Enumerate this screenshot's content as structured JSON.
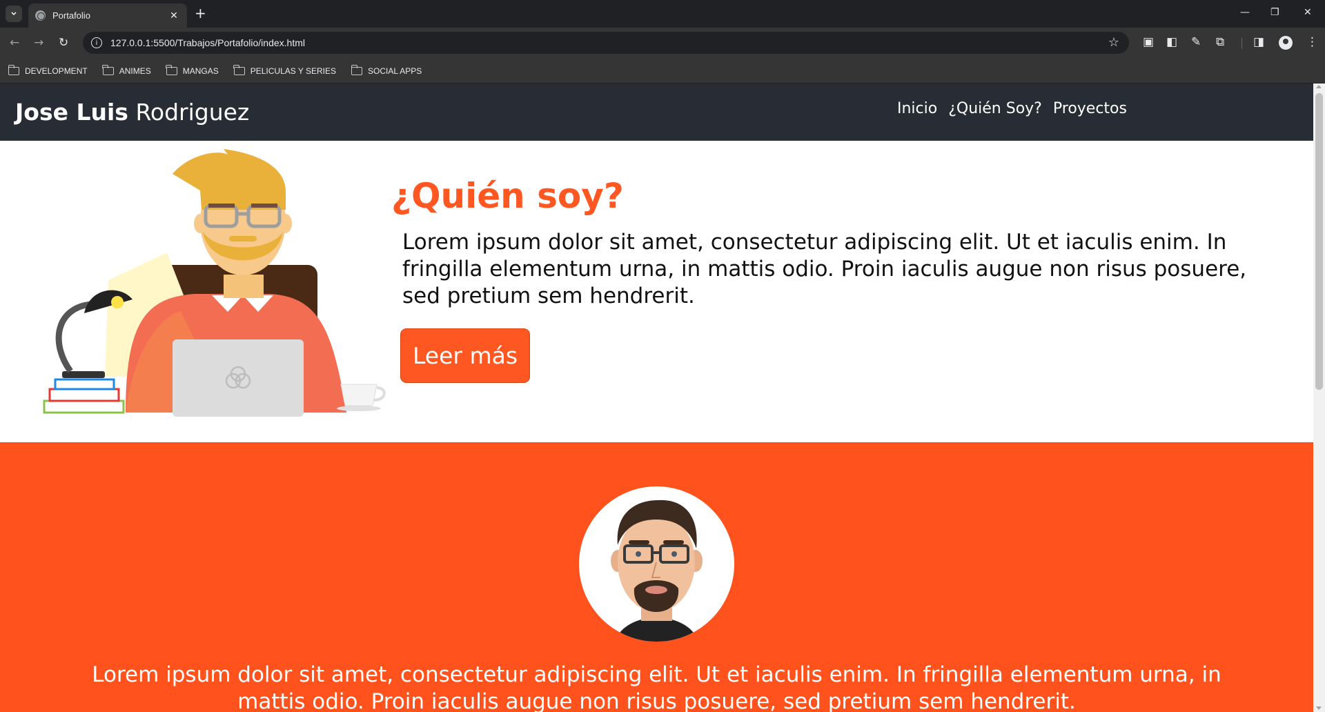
{
  "browser": {
    "tab_title": "Portafolio",
    "url": "127.0.0.1:5500/Trabajos/Portafolio/index.html",
    "bookmarks": [
      "DEVELOPMENT",
      "ANIMES",
      "MANGAS",
      "PELICULAS Y SERIES",
      "SOCIAL APPS"
    ]
  },
  "header": {
    "brand_first": "Jose Luis",
    "brand_last": "Rodriguez",
    "nav": [
      "Inicio",
      "¿Quién Soy?",
      "Proyectos"
    ]
  },
  "hero": {
    "title": "¿Quién soy?",
    "text": "Lorem ipsum dolor sit amet, consectetur adipiscing elit. Ut et iaculis enim. In fringilla elementum urna, in mattis odio. Proin iaculis augue non risus posuere, sed pretium sem hendrerit.",
    "button": "Leer más"
  },
  "about": {
    "text": "Lorem ipsum dolor sit amet, consectetur adipiscing elit. Ut et iaculis enim. In fringilla elementum urna, in mattis odio. Proin iaculis augue non risus posuere, sed pretium sem hendrerit."
  },
  "colors": {
    "accent": "#ff5722",
    "header_bg": "#282c34",
    "about_bg": "#ff521c"
  }
}
